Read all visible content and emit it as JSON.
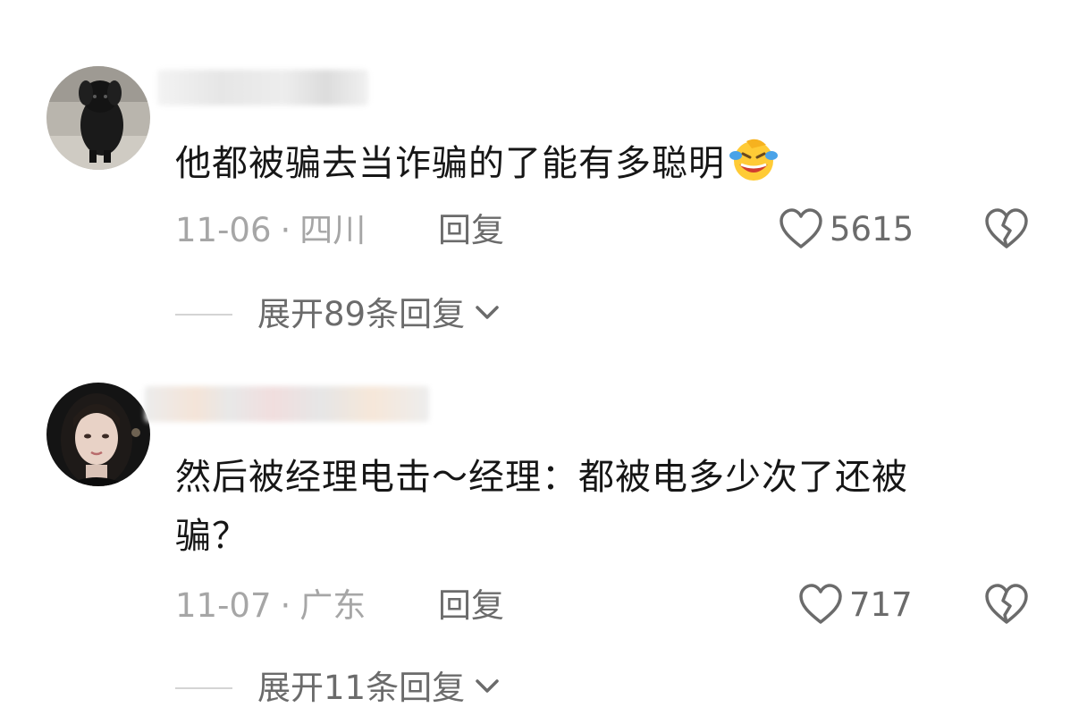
{
  "comments": [
    {
      "text": "他都被骗去当诈骗的了能有多聪明",
      "emoji": "rofl-emoji",
      "date": "11-06",
      "location": "四川",
      "reply_label": "回复",
      "like_count": "5615",
      "expand_label": "展开89条回复"
    },
    {
      "text_line1": "然后被经理电击～经理：都被电多少次了还被",
      "text_line2": "骗？",
      "date": "11-07",
      "location": "广东",
      "reply_label": "回复",
      "like_count": "717",
      "expand_label": "展开11条回复"
    }
  ],
  "meta_separator": "·",
  "icons": {
    "like": "heart-outline-icon",
    "dislike": "broken-heart-icon",
    "expand": "chevron-down-icon"
  },
  "colors": {
    "text": "#161616",
    "meta": "#a6a6a6",
    "action": "#6b6b6b"
  }
}
